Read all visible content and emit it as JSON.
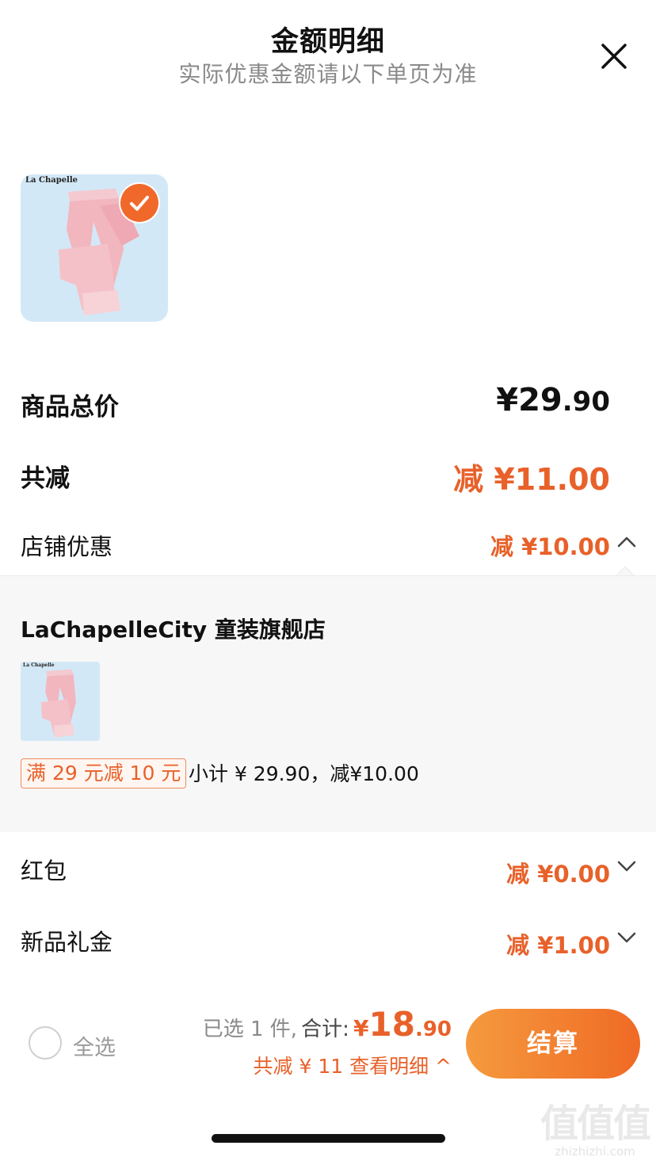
{
  "header": {
    "title": "金额明细",
    "subtitle": "实际优惠金额请以下单页为准",
    "close_icon": "close-icon"
  },
  "product": {
    "brand": "La Chapelle",
    "image": "pink-pants-photo",
    "selected": true
  },
  "price": {
    "total_label": "商品总价",
    "total_currency": "¥",
    "total_int": "29",
    "total_dec": ".90",
    "reduce_label": "共减",
    "reduce_value": "减 ¥11.00"
  },
  "discounts": [
    {
      "label": "店铺优惠",
      "value": "减 ¥10.00",
      "chevron": "chevron-up-icon",
      "expanded": true
    },
    {
      "label": "红包",
      "value": "减 ¥0.00",
      "chevron": "chevron-down-icon",
      "expanded": false
    },
    {
      "label": "新品礼金",
      "value": "减 ¥1.00",
      "chevron": "chevron-down-icon",
      "expanded": false
    }
  ],
  "store": {
    "name": "LaChapelleCity 童装旗舰店",
    "thumb_brand": "La Chapelle",
    "promo_tag": "满 29 元减 10 元",
    "summary": "小计 ¥ 29.90，减¥10.00"
  },
  "bottom": {
    "select_all": "全选",
    "selected_prefix": "已选 1 件,",
    "sum_label": "合计:",
    "sum_currency": "¥",
    "sum_int": "18",
    "sum_dec": ".90",
    "detail_link": "共减 ¥ 11  查看明细 ^",
    "checkout": "结算"
  },
  "watermark": {
    "glyphs": "值值值",
    "url": "zhizhizhi.com"
  },
  "colors": {
    "accent": "#e8612a",
    "button_start": "#f59a3e",
    "button_end": "#ef6a25",
    "panel_bg": "#f7f7f7",
    "thumb_bg": "#d3e8f6"
  }
}
